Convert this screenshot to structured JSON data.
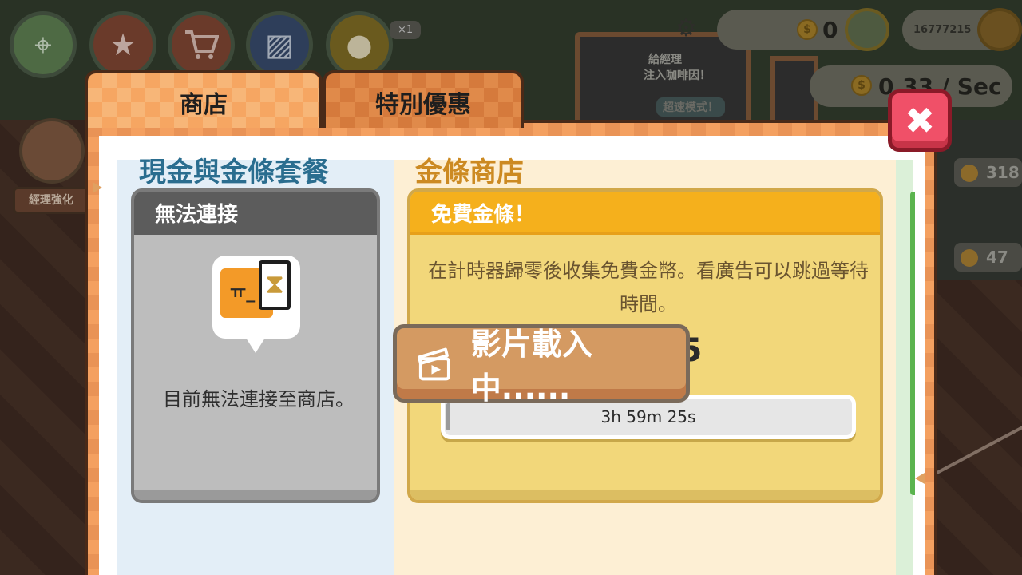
{
  "background": {
    "hud": {
      "speed_multiplier": "×1",
      "cash_value": "0",
      "gold_value": "16777215",
      "income_rate": "0.33 / Sec",
      "manager_upgrade_label": "經理強化",
      "board_text_1": "給經理",
      "board_text_2": "注入咖啡因！",
      "board_button": "超速模式！",
      "side_value_1": "318",
      "side_value_2": "47"
    }
  },
  "tabs": {
    "shop": "商店",
    "special_offers": "特別優惠"
  },
  "sections": {
    "cash_gold_bundles": "現金與金條套餐",
    "gold_shop": "金條商店"
  },
  "connection_card": {
    "header": "無法連接",
    "message": "目前無法連接至商店。",
    "icon_face": "ㅠ_"
  },
  "free_gold_card": {
    "header": "免費金條！",
    "description": "在計時器歸零後收集免費金幣。看廣告可以跳過等待時間。",
    "reward": "+5",
    "timer": "3h 59m 25s",
    "timer_progress": 0.01
  },
  "video_button": {
    "label": "影片載入中......"
  },
  "close_button": {
    "label": "✖"
  },
  "colors": {
    "cash_title": "#2a6d8f",
    "gold_title": "#cc8a22",
    "gold_header": "#f5b01c",
    "close_red": "#f05068"
  },
  "icons": [
    "map-icon",
    "star-icon",
    "cart-icon",
    "cards-icon",
    "coffee-bean-icon",
    "gear-icon",
    "coin-icon",
    "cash-stack-icon",
    "gold-bar-icon",
    "sad-face-icon",
    "hourglass-icon",
    "clapperboard-icon",
    "close-icon"
  ]
}
